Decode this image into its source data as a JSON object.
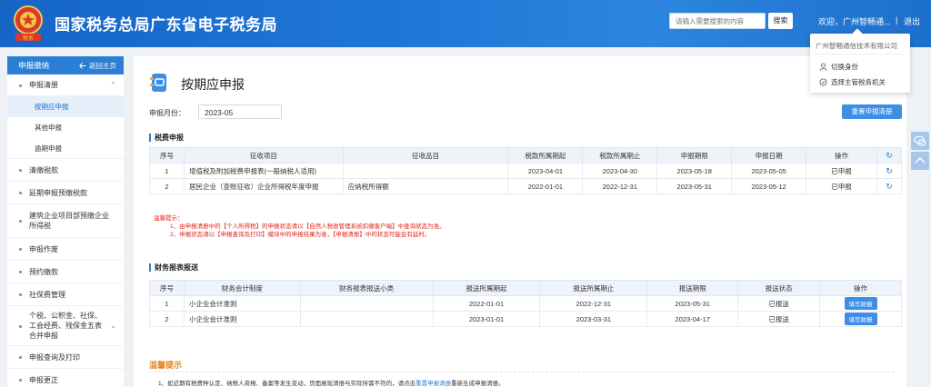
{
  "header": {
    "title": "国家税务总局广东省电子税务局",
    "search_placeholder": "请输入需要搜索的内容",
    "search_button": "搜索",
    "welcome": "欢迎，广州智畅通...",
    "separator": "|",
    "logout": "退出",
    "emblem_text": "税务",
    "brand_color": "#1f78d6"
  },
  "user_menu": {
    "company": "广州智畅通信技术有限公司",
    "items": [
      "切换身份",
      "选择主管税务机关"
    ]
  },
  "sidebar": {
    "title": "申报缴纳",
    "back": "返回主页",
    "items": [
      {
        "label": "申报清册"
      },
      {
        "label": "按期应申报",
        "sub": true,
        "active": true
      },
      {
        "label": "其他申报",
        "sub": true
      },
      {
        "label": "逾期申报",
        "sub": true
      },
      {
        "label": "清缴税款"
      },
      {
        "label": "延期申报预缴税款"
      },
      {
        "label": "建筑企业项目部预缴企业所得税"
      },
      {
        "label": "申报作废"
      },
      {
        "label": "预约缴款"
      },
      {
        "label": "社保费管理"
      },
      {
        "label": "个税、公积金、社保、工会经费、残保金五表合并申报"
      },
      {
        "label": "申报查询及打印"
      },
      {
        "label": "申报更正"
      }
    ]
  },
  "main": {
    "page_title": "按期应申报",
    "month_label": "申报月份：",
    "month_value": "2023-05",
    "refresh_button": "重置申报清册",
    "tax_section": "税费申报",
    "tax_table": {
      "headers": [
        "序号",
        "征收项目",
        "征收品目",
        "税款所属期起",
        "税款所属期止",
        "申报期限",
        "申报日期",
        "操作"
      ],
      "rows": [
        [
          "1",
          "增值税及附加税费申报表(一般纳税人适用)",
          "",
          "2023-04-01",
          "2023-04-30",
          "2023-05-18",
          "2023-05-05",
          "已申报"
        ],
        [
          "2",
          "居民企业（查账征收）企业所得税年度申报",
          "应纳税所得额",
          "2022-01-01",
          "2022-12-31",
          "2023-05-31",
          "2023-05-12",
          "已申报"
        ]
      ]
    },
    "tips": {
      "title": "温馨提示：",
      "lines": [
        "1、由申报清册中的【个人所得税】的申报状态请以【自然人税收管理系统扣缴客户端】中查询状态为准。",
        "2、申报状态请以【申报查询及打印】模块中的申报结果为准，【申报清册】中的状态可能会有延时。"
      ]
    },
    "finance_section": "财务报表报送",
    "finance_table": {
      "headers": [
        "序号",
        "财务会计制度",
        "财务报表报送小类",
        "报送所属期起",
        "报送所属期止",
        "报送期限",
        "报送状态",
        "操作"
      ],
      "rows": [
        [
          "1",
          "小企业会计准则",
          "",
          "2022-01-01",
          "2022-12-31",
          "2023-05-31",
          "已报送",
          "填写财报"
        ],
        [
          "2",
          "小企业会计准则",
          "",
          "2023-01-01",
          "2023-03-31",
          "2023-04-17",
          "已报送",
          "填写财报"
        ]
      ]
    },
    "bottom": {
      "title": "温馨提示",
      "text_before": "1、如近期有税费种认定、纳税人资格、备案等发生变动，页面展现清册与实际所需不符的，请点击",
      "link": "重置申报清册",
      "text_after": "重新生成申报清册。"
    }
  }
}
